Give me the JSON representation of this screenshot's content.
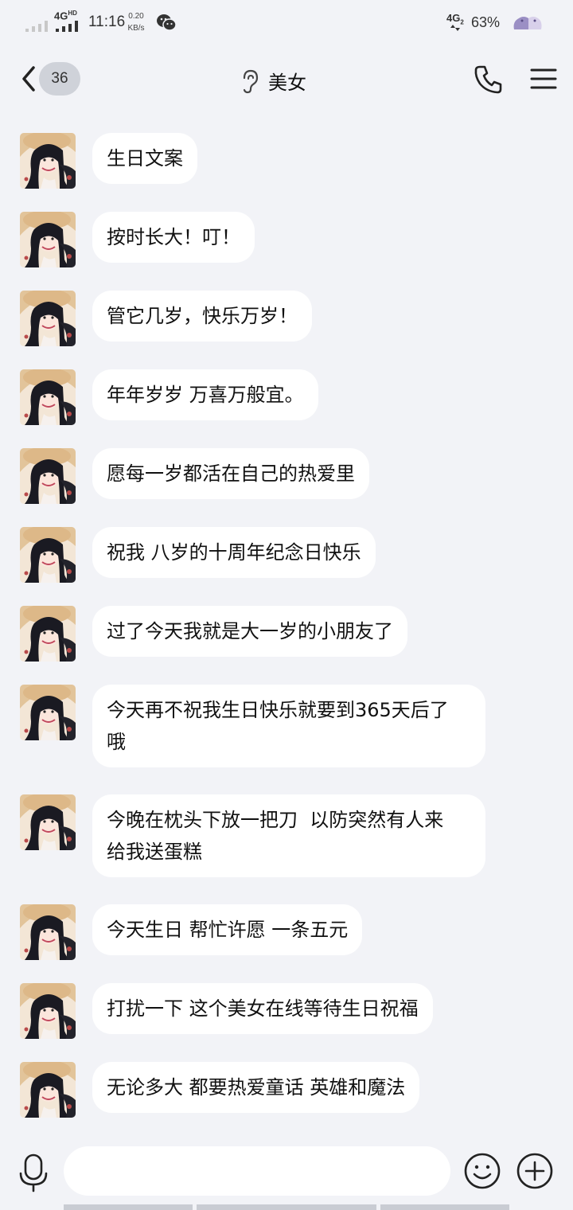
{
  "status_bar": {
    "network": "4G",
    "network_hd": "HD",
    "time": "11:16",
    "speed_value": "0.20",
    "speed_unit": "KB/s",
    "sim2_network": "4G",
    "sim2_index": "2",
    "battery": "63%"
  },
  "header": {
    "unread_count": "36",
    "title": "美女"
  },
  "messages": [
    "生日文案",
    "按时长大！叮！",
    "管它几岁，快乐万岁！",
    "年年岁岁 万喜万般宜。",
    "愿每一岁都活在自己的热爱里",
    "祝我 八岁的十周年纪念日快乐",
    "过了今天我就是大一岁的小朋友了",
    "今天再不祝我生日快乐就要到365天后了\n哦",
    "今晚在枕头下放一把刀  以防突然有人来\n给我送蛋糕",
    "今天生日 帮忙许愿 一条五元",
    "打扰一下 这个美女在线等待生日祝福",
    "无论多大 都要热爱童话 英雄和魔法"
  ],
  "input": {
    "placeholder": ""
  },
  "colors": {
    "background": "#f2f3f7",
    "bubble": "#ffffff",
    "badge": "#cfd2d9"
  }
}
